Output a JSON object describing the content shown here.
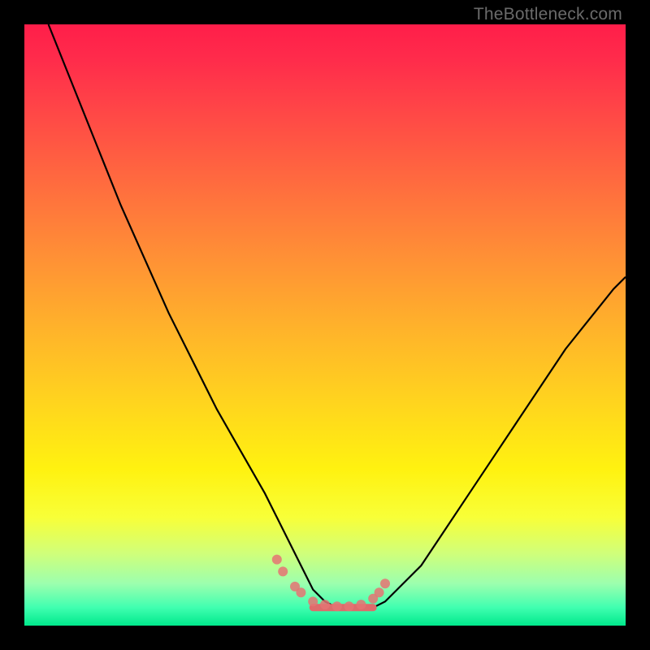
{
  "watermark": "TheBottleneck.com",
  "frame_color": "#000000",
  "gradient_colors": [
    "#ff1e4a",
    "#ff4547",
    "#ff8e36",
    "#ffd21f",
    "#fff210",
    "#9cffae",
    "#00e98c"
  ],
  "chart_data": {
    "type": "line",
    "title": "",
    "xlabel": "",
    "ylabel": "",
    "xlim": [
      0,
      100
    ],
    "ylim": [
      0,
      100
    ],
    "x": [
      4,
      8,
      12,
      16,
      20,
      24,
      28,
      32,
      36,
      40,
      42,
      44,
      46,
      48,
      50,
      52,
      54,
      56,
      58,
      60,
      62,
      66,
      70,
      74,
      78,
      82,
      86,
      90,
      94,
      98,
      100
    ],
    "y": [
      100,
      90,
      80,
      70,
      61,
      52,
      44,
      36,
      29,
      22,
      18,
      14,
      10,
      6,
      4,
      3,
      3,
      3,
      3,
      4,
      6,
      10,
      16,
      22,
      28,
      34,
      40,
      46,
      51,
      56,
      58
    ],
    "marker_points_x": [
      42,
      43,
      45,
      46,
      48,
      50,
      52,
      54,
      56,
      58,
      59,
      60
    ],
    "marker_points_y": [
      11,
      9,
      6.5,
      5.5,
      4,
      3.5,
      3.2,
      3.2,
      3.5,
      4.5,
      5.5,
      7
    ],
    "plateau_x": [
      48,
      58
    ],
    "plateau_y": 3
  }
}
